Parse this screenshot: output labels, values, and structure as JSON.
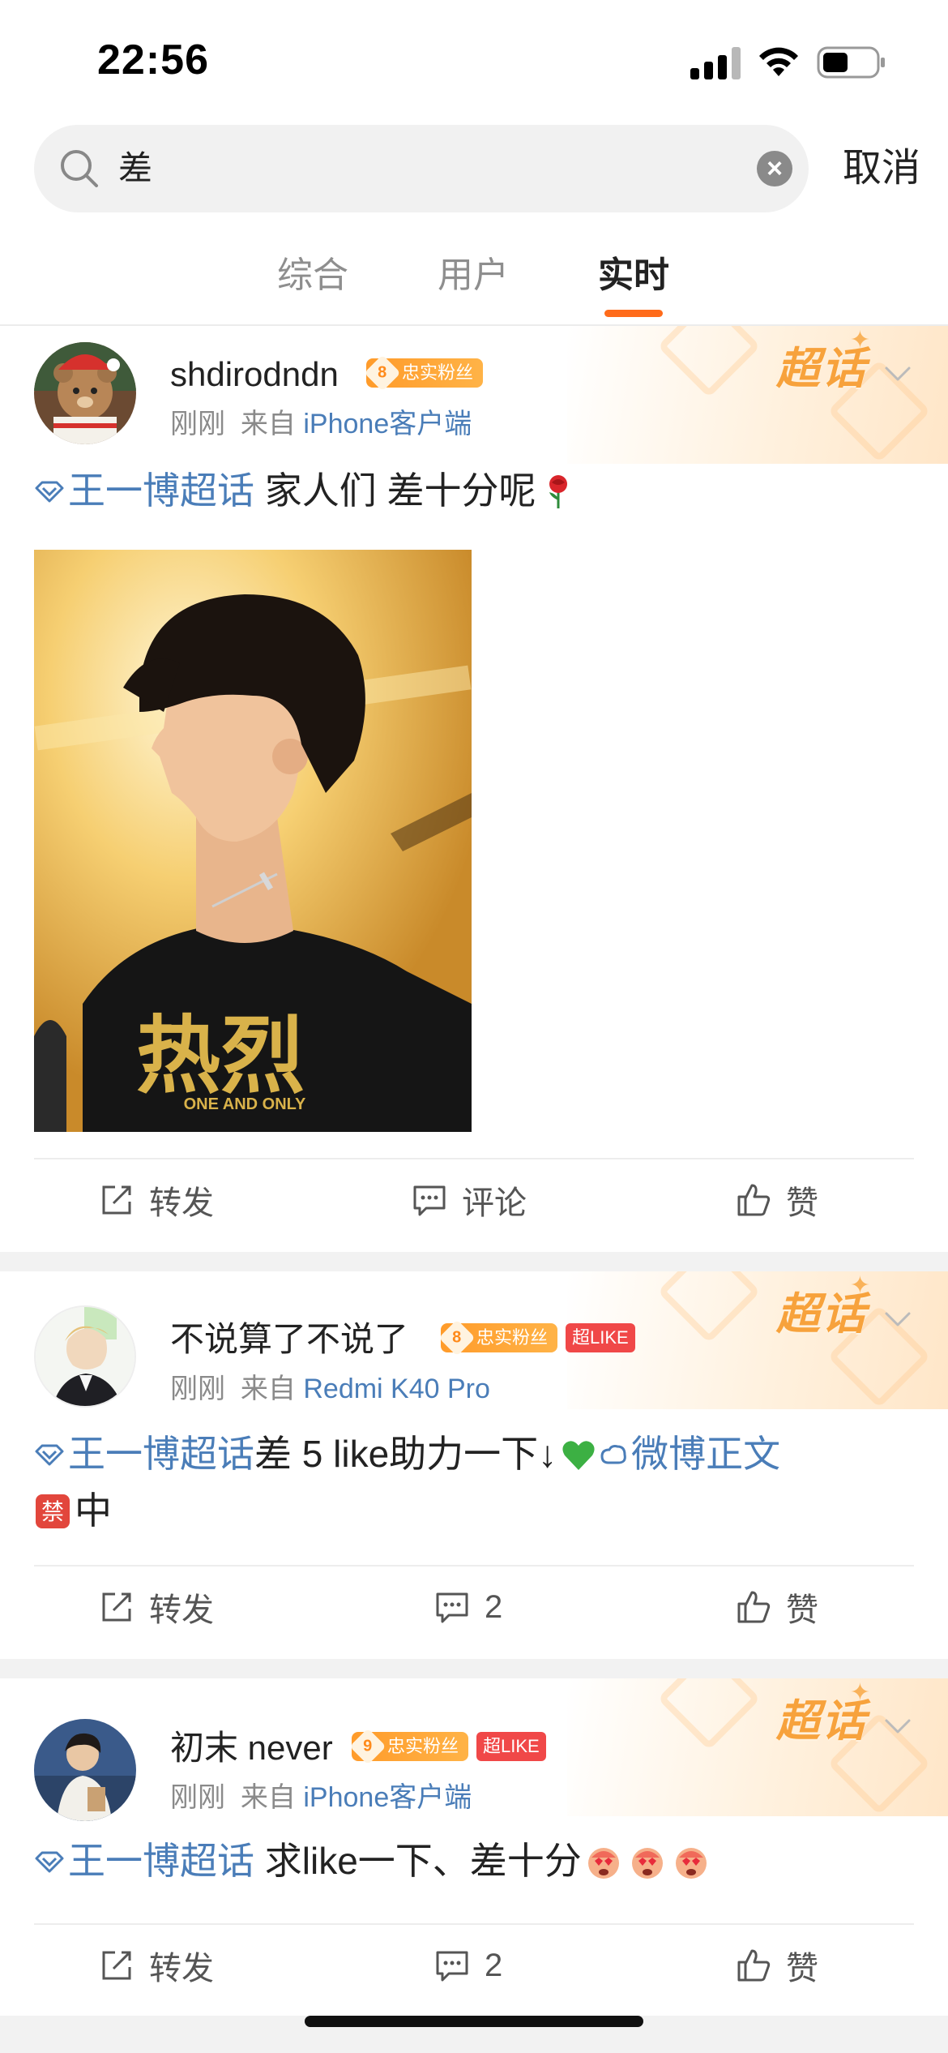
{
  "status_bar": {
    "time": "22:56"
  },
  "search": {
    "query": "差",
    "cancel_label": "取消"
  },
  "tabs": [
    {
      "label": "综合",
      "active": false
    },
    {
      "label": "用户",
      "active": false
    },
    {
      "label": "实时",
      "active": true
    }
  ],
  "colors": {
    "accent": "#ff6b1a",
    "link": "#4a7db8",
    "fan_badge": "#ff9b2a",
    "like_badge": "#f04848"
  },
  "posts": [
    {
      "username": "shdirodndn",
      "fan_level": "8",
      "fan_badge": "忠实粉丝",
      "like_badge": "",
      "time": "刚刚",
      "from_label": "来自",
      "source": "iPhone客户端",
      "topic": "王一博超话",
      "text": " 家人们 差十分呢",
      "emoji": "rose",
      "image_shirt_text": "热烈",
      "image_shirt_sub": "ONE AND ONLY",
      "corner_badge": "超话",
      "actions": {
        "repost": "转发",
        "comment": "评论",
        "like": "赞"
      }
    },
    {
      "username": "不说算了不说了",
      "fan_level": "8",
      "fan_badge": "忠实粉丝",
      "like_badge": "超LIKE",
      "time": "刚刚",
      "from_label": "来自",
      "source": "Redmi K40 Pro",
      "topic": "王一博超话",
      "text": "差 5 like助力一下↓",
      "link_text": "微博正文",
      "line2": "中",
      "corner_badge": "超话",
      "actions": {
        "repost": "转发",
        "comment": "2",
        "like": "赞"
      }
    },
    {
      "username": "初末 never",
      "fan_level": "9",
      "fan_badge": "忠实粉丝",
      "like_badge": "超LIKE",
      "time": "刚刚",
      "from_label": "来自",
      "source": "iPhone客户端",
      "topic": "王一博超话",
      "text": " 求like一下、差十分",
      "corner_badge": "超话",
      "actions": {
        "repost": "转发",
        "comment": "2",
        "like": "赞"
      }
    }
  ]
}
